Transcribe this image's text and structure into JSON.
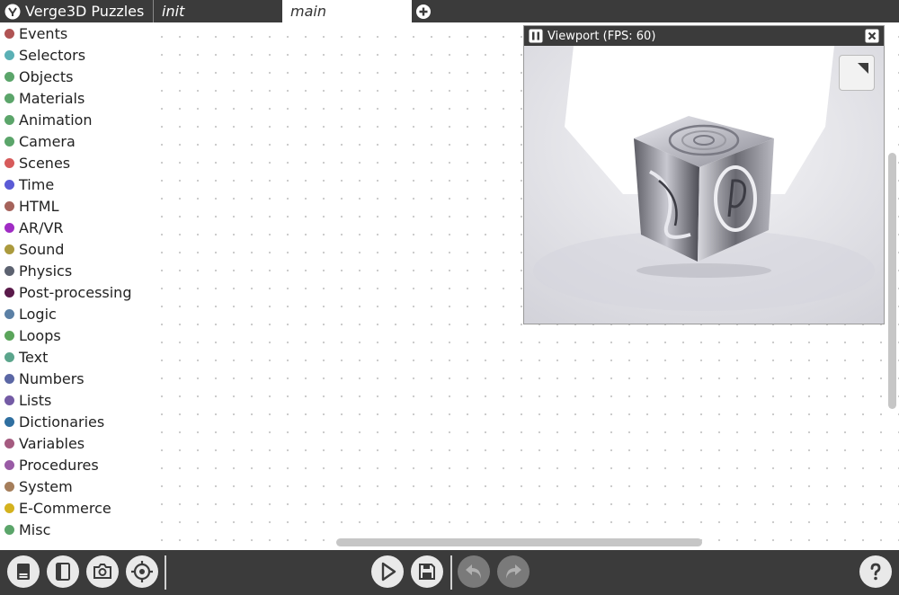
{
  "app": {
    "title": "Verge3D Puzzles"
  },
  "tabs": [
    {
      "label": "init"
    },
    {
      "label": "main"
    }
  ],
  "sidebar": {
    "categories": [
      {
        "label": "Events",
        "color": "#b05454"
      },
      {
        "label": "Selectors",
        "color": "#5bb0b5"
      },
      {
        "label": "Objects",
        "color": "#5ba56a"
      },
      {
        "label": "Materials",
        "color": "#5ba56a"
      },
      {
        "label": "Animation",
        "color": "#5ba56a"
      },
      {
        "label": "Camera",
        "color": "#5ba56a"
      },
      {
        "label": "Scenes",
        "color": "#d75b5b"
      },
      {
        "label": "Time",
        "color": "#5b5bd6"
      },
      {
        "label": "HTML",
        "color": "#a5635b"
      },
      {
        "label": "AR/VR",
        "color": "#a02cc4"
      },
      {
        "label": "Sound",
        "color": "#ab9a3d"
      },
      {
        "label": "Physics",
        "color": "#5c6270"
      },
      {
        "label": "Post-processing",
        "color": "#5a1a4a"
      },
      {
        "label": "Logic",
        "color": "#5b80a5"
      },
      {
        "label": "Loops",
        "color": "#5ba55b"
      },
      {
        "label": "Text",
        "color": "#5ba58c"
      },
      {
        "label": "Numbers",
        "color": "#5b67a5"
      },
      {
        "label": "Lists",
        "color": "#745ba5"
      },
      {
        "label": "Dictionaries",
        "color": "#2f6fa0"
      },
      {
        "label": "Variables",
        "color": "#a55b80"
      },
      {
        "label": "Procedures",
        "color": "#995ba5"
      },
      {
        "label": "System",
        "color": "#a57e5b"
      },
      {
        "label": "E-Commerce",
        "color": "#d4b21e"
      },
      {
        "label": "Misc",
        "color": "#5ba56a"
      }
    ]
  },
  "viewport": {
    "title": "Viewport (FPS: 60)"
  },
  "toolbar": {
    "left_buttons": [
      "library-icon",
      "book-icon",
      "camera-icon",
      "target-icon"
    ],
    "center_buttons": [
      "play-icon",
      "save-icon"
    ],
    "history_buttons": [
      "undo-icon",
      "redo-icon"
    ],
    "help_icon": "help-icon"
  }
}
